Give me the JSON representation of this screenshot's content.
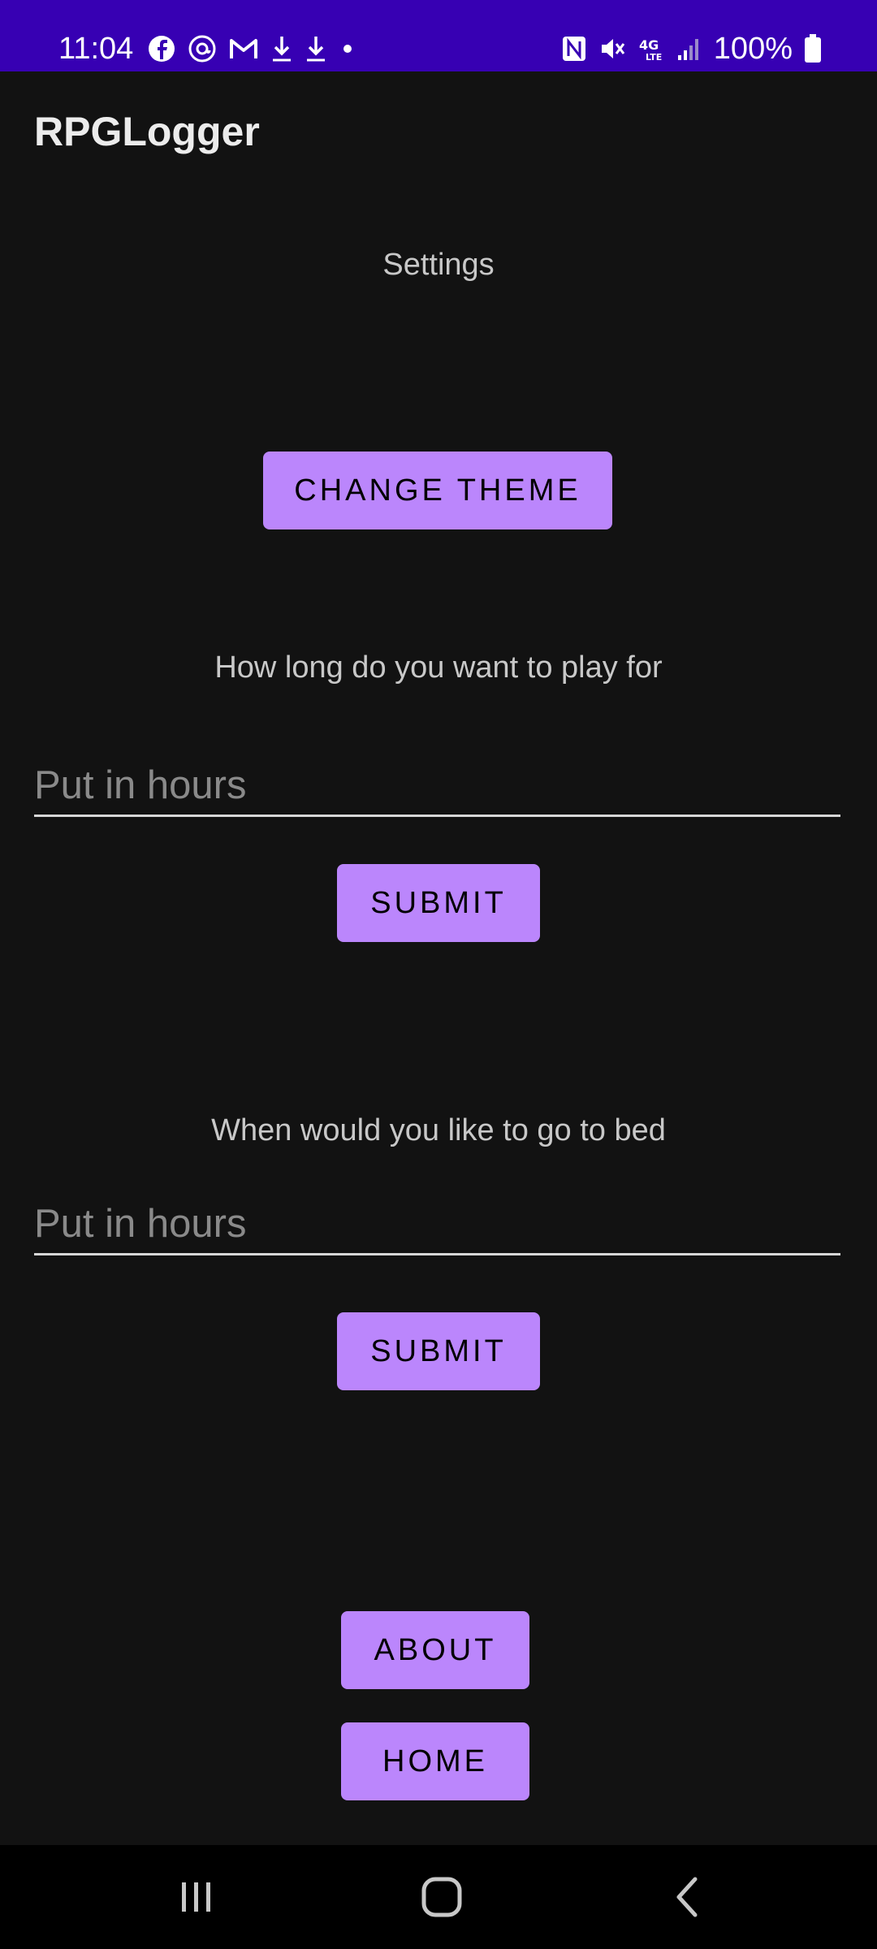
{
  "status_bar": {
    "time": "11:04",
    "battery_text": "100%",
    "left_icons": [
      "facebook-icon",
      "threads-icon",
      "gmail-icon",
      "download-icon",
      "download-icon",
      "dot-icon"
    ],
    "right_icons": [
      "nfc-icon",
      "mute-icon",
      "4g-lte-icon",
      "signal-icon",
      "battery-icon"
    ],
    "network_label": "4G"
  },
  "app_bar": {
    "title": "RPGLogger"
  },
  "settings": {
    "heading": "Settings",
    "change_theme_label": "CHANGE THEME",
    "play_prompt": "How long do you want to play for",
    "play_input_placeholder": "Put in hours",
    "play_submit_label": "SUBMIT",
    "bed_prompt": "When would you like to go to bed",
    "bed_input_placeholder": "Put in hours",
    "bed_submit_label": "SUBMIT",
    "about_label": "ABOUT",
    "home_label": "HOME"
  },
  "nav_bar": {
    "icons": [
      "recents-icon",
      "home-icon",
      "back-icon"
    ]
  },
  "colors": {
    "status_bar": "#3700b3",
    "background": "#121212",
    "button": "#bb86fc",
    "nav_bar": "#000000"
  }
}
